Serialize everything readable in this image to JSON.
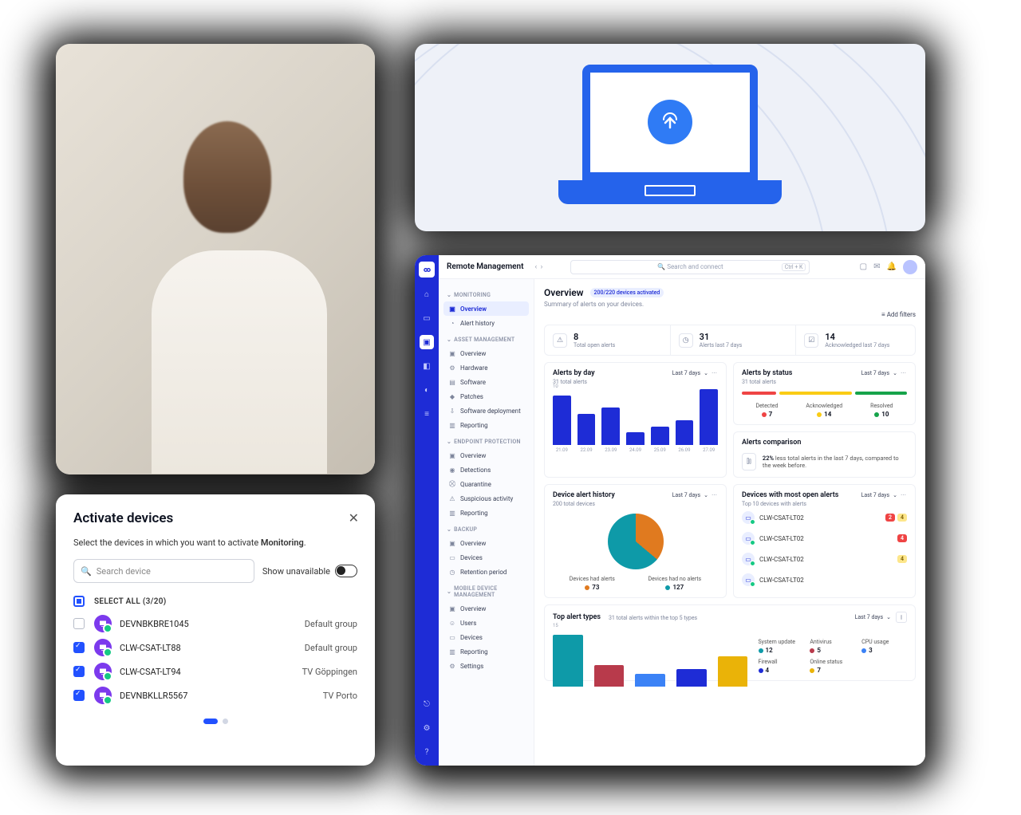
{
  "activate": {
    "title": "Activate devices",
    "instruction_prefix": "Select the devices in which you want to activate ",
    "instruction_bold": "Monitoring",
    "instruction_suffix": ".",
    "search_placeholder": "Search device",
    "show_unavailable": "Show unavailable",
    "select_all_label": "SELECT ALL (3/20)",
    "devices": [
      {
        "checked": false,
        "name": "DEVNBKBRE1045",
        "group": "Default group"
      },
      {
        "checked": true,
        "name": "CLW-CSAT-LT88",
        "group": "Default group"
      },
      {
        "checked": true,
        "name": "CLW-CSAT-LT94",
        "group": "TV Göppingen"
      },
      {
        "checked": true,
        "name": "DEVNBKLLR5567",
        "group": "TV Porto"
      }
    ]
  },
  "dashboard": {
    "app_title": "Remote Management",
    "search_placeholder": "Search and connect",
    "search_kbd": "Ctrl + K",
    "sidebar": {
      "sections": [
        {
          "label": "MONITORING",
          "items": [
            {
              "icon": "▣",
              "label": "Overview",
              "active": true
            },
            {
              "icon": "◔",
              "label": "Alert history"
            }
          ]
        },
        {
          "label": "ASSET MANAGEMENT",
          "items": [
            {
              "icon": "▣",
              "label": "Overview"
            },
            {
              "icon": "⚙",
              "label": "Hardware"
            },
            {
              "icon": "▤",
              "label": "Software"
            },
            {
              "icon": "◆",
              "label": "Patches"
            },
            {
              "icon": "⇩",
              "label": "Software deployment"
            },
            {
              "icon": "▥",
              "label": "Reporting"
            }
          ]
        },
        {
          "label": "ENDPOINT PROTECTION",
          "items": [
            {
              "icon": "▣",
              "label": "Overview"
            },
            {
              "icon": "◉",
              "label": "Detections"
            },
            {
              "icon": "⛒",
              "label": "Quarantine"
            },
            {
              "icon": "⚠",
              "label": "Suspicious activity"
            },
            {
              "icon": "▥",
              "label": "Reporting"
            }
          ]
        },
        {
          "label": "BACKUP",
          "items": [
            {
              "icon": "▣",
              "label": "Overview"
            },
            {
              "icon": "▭",
              "label": "Devices"
            },
            {
              "icon": "◷",
              "label": "Retention period"
            }
          ]
        },
        {
          "label": "MOBILE DEVICE MANAGEMENT",
          "items": [
            {
              "icon": "▣",
              "label": "Overview"
            },
            {
              "icon": "☺",
              "label": "Users"
            },
            {
              "icon": "▭",
              "label": "Devices"
            },
            {
              "icon": "▥",
              "label": "Reporting"
            },
            {
              "icon": "⚙",
              "label": "Settings"
            }
          ]
        }
      ]
    },
    "overview": {
      "heading": "Overview",
      "badge": "200/220 devices activated",
      "subtitle": "Summary of alerts on your devices.",
      "add_filters": "Add filters",
      "stats": [
        {
          "icon": "⚠",
          "value": "8",
          "label": "Total open alerts"
        },
        {
          "icon": "◷",
          "value": "31",
          "label": "Alerts last 7 days"
        },
        {
          "icon": "☑",
          "value": "14",
          "label": "Acknowledged last 7 days"
        }
      ],
      "range_label": "Last 7 days"
    },
    "alerts_by_day": {
      "title": "Alerts by day",
      "sub": "31 total alerts",
      "ylabel": "10"
    },
    "alerts_by_status": {
      "title": "Alerts by status",
      "sub": "31 total alerts",
      "legend": [
        {
          "label": "Detected",
          "value": "7",
          "color": "#ef4444"
        },
        {
          "label": "Acknowledged",
          "value": "14",
          "color": "#facc15"
        },
        {
          "label": "Resolved",
          "value": "10",
          "color": "#16a34a"
        }
      ]
    },
    "comparison": {
      "title": "Alerts comparison",
      "pct": "22%",
      "text": " less total alerts in the last 7 days, compared to the week before."
    },
    "device_history": {
      "title": "Device alert history",
      "sub": "200 total devices",
      "legend": [
        {
          "label": "Devices had alerts",
          "value": "73",
          "color": "#e07a1f"
        },
        {
          "label": "Devices had no alerts",
          "value": "127",
          "color": "#0e9aa8"
        }
      ]
    },
    "most_open": {
      "title": "Devices with most open alerts",
      "sub": "Top 10 devices with alerts",
      "rows": [
        {
          "name": "CLW-CSAT-LT02",
          "badges": [
            {
              "n": "2",
              "c": "red"
            },
            {
              "n": "4",
              "c": "yellow"
            }
          ]
        },
        {
          "name": "CLW-CSAT-LT02",
          "badges": [
            {
              "n": "4",
              "c": "red"
            }
          ]
        },
        {
          "name": "CLW-CSAT-LT02",
          "badges": [
            {
              "n": "4",
              "c": "yellow"
            }
          ]
        },
        {
          "name": "CLW-CSAT-LT02",
          "badges": []
        }
      ]
    },
    "top_types": {
      "title": "Top alert types",
      "sub": "31 total alerts within the top 5 types",
      "ylabel": "15",
      "legend": [
        {
          "label": "System update",
          "value": "12",
          "color": "#0e9aa8"
        },
        {
          "label": "Antivirus",
          "value": "5",
          "color": "#b83a4b"
        },
        {
          "label": "CPU usage",
          "value": "3",
          "color": "#3b82f6"
        },
        {
          "label": "Firewall",
          "value": "4",
          "color": "#1e2cd6"
        },
        {
          "label": "Online status",
          "value": "7",
          "color": "#eab308"
        }
      ]
    }
  },
  "chart_data": [
    {
      "type": "bar",
      "title": "Alerts by day",
      "categories": [
        "21.09",
        "22.09",
        "23.09",
        "24.09",
        "25.09",
        "26.09",
        "27.09"
      ],
      "values": [
        8,
        5,
        6,
        2,
        3,
        4,
        9
      ],
      "ylabel": "",
      "ylim": [
        0,
        10
      ]
    },
    {
      "type": "bar",
      "title": "Alerts by status",
      "categories": [
        "Detected",
        "Acknowledged",
        "Resolved"
      ],
      "values": [
        7,
        14,
        10
      ]
    },
    {
      "type": "pie",
      "title": "Device alert history",
      "categories": [
        "Devices had alerts",
        "Devices had no alerts"
      ],
      "values": [
        73,
        127
      ]
    },
    {
      "type": "bar",
      "title": "Top alert types",
      "categories": [
        "System update",
        "Antivirus",
        "CPU usage",
        "Firewall",
        "Online status"
      ],
      "values": [
        12,
        5,
        3,
        4,
        7
      ],
      "ylim": [
        0,
        15
      ]
    }
  ]
}
